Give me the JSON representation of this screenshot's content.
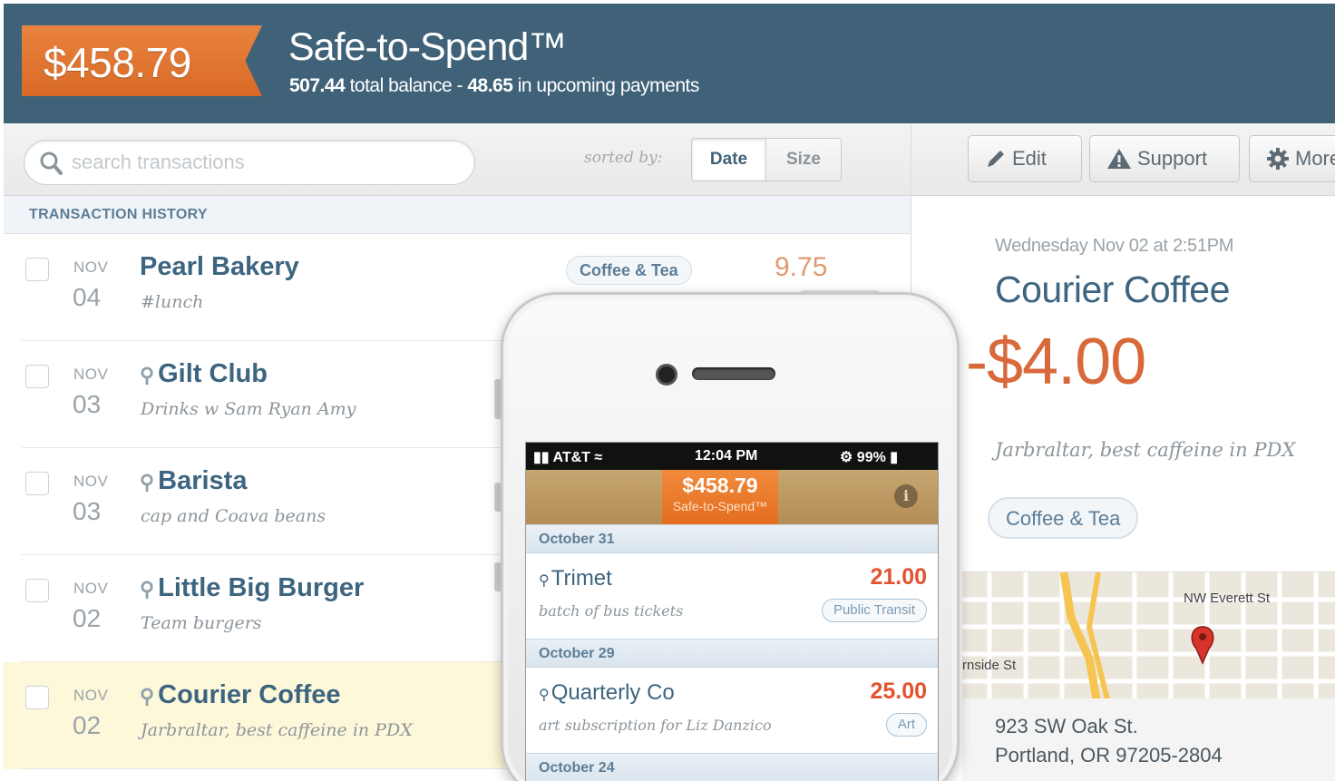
{
  "header": {
    "safe_amount": "$458.79",
    "title": "Safe-to-Spend™",
    "total_balance": "507.44",
    "total_balance_label": "total balance -",
    "upcoming": "48.65",
    "upcoming_label": "in upcoming payments"
  },
  "search": {
    "placeholder": "search transactions",
    "value": ""
  },
  "sort": {
    "label": "sorted by:",
    "options": [
      "Date",
      "Size"
    ],
    "selected": "Date"
  },
  "history_label": "TRANSACTION HISTORY",
  "transactions": [
    {
      "month": "NOV",
      "day": "04",
      "name": "Pearl Bakery",
      "memo": "#lunch",
      "category": "Coffee & Tea",
      "amount": "9.75",
      "located": false
    },
    {
      "month": "NOV",
      "day": "03",
      "name": "Gilt Club",
      "memo": "Drinks w Sam Ryan Amy",
      "located": true
    },
    {
      "month": "NOV",
      "day": "03",
      "name": "Barista",
      "memo": "cap and Coava beans",
      "located": true
    },
    {
      "month": "NOV",
      "day": "02",
      "name": "Little Big Burger",
      "memo": "Team burgers",
      "located": true
    },
    {
      "month": "NOV",
      "day": "02",
      "name": "Courier Coffee",
      "memo": "Jarbraltar, best caffeine in PDX",
      "located": true,
      "selected": true
    }
  ],
  "toolbar": {
    "edit": "Edit",
    "support": "Support",
    "more": "More"
  },
  "detail": {
    "datetime": "Wednesday Nov 02 at 2:51PM",
    "name": "Courier Coffee",
    "amount": "-$4.00",
    "memo": "Jarbraltar, best caffeine in PDX",
    "category": "Coffee & Tea",
    "map_labels": {
      "street1": "NW Everett St",
      "street2": "rnside St"
    },
    "address_line1": "923 SW Oak St.",
    "address_line2": "Portland, OR 97205-2804"
  },
  "phone": {
    "carrier": "AT&T",
    "time": "12:04 PM",
    "battery": "99%",
    "safe_amount": "$458.79",
    "safe_label": "Safe-to-Spend™",
    "sections": [
      {
        "date": "October 31",
        "items": [
          {
            "name": "Trimet",
            "memo": "batch of bus tickets",
            "amount": "21.00",
            "category": "Public Transit"
          }
        ]
      },
      {
        "date": "October 29",
        "items": [
          {
            "name": "Quarterly Co",
            "memo": "art subscription for Liz Danzico",
            "amount": "25.00",
            "category": "Art"
          }
        ]
      },
      {
        "date": "October 24",
        "items": []
      }
    ]
  },
  "colors": {
    "header": "#3f6278",
    "accent": "#e0742c",
    "amount_negative": "#d8693a",
    "highlight_row": "#fdf8d9"
  }
}
